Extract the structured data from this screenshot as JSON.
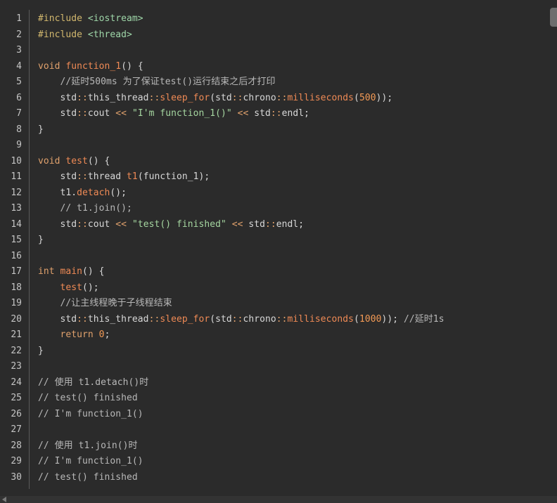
{
  "colors": {
    "background": "#2b2b2b",
    "line_number": "#c5c5c5",
    "preprocessor": "#d2b86e",
    "header": "#9fd7a9",
    "keyword": "#e0a16c",
    "function": "#ef8a55",
    "string": "#a5d6a0",
    "number": "#f39a55",
    "comment": "#b8b8b8",
    "plain": "#d8d8d8"
  },
  "editor": {
    "lines": [
      {
        "n": "1",
        "tokens": [
          [
            "pp",
            "#include"
          ],
          [
            "pl",
            " "
          ],
          [
            "hd",
            "<iostream>"
          ]
        ]
      },
      {
        "n": "2",
        "tokens": [
          [
            "pp",
            "#include"
          ],
          [
            "pl",
            " "
          ],
          [
            "hd",
            "<thread>"
          ]
        ]
      },
      {
        "n": "3",
        "tokens": []
      },
      {
        "n": "4",
        "tokens": [
          [
            "kw",
            "void"
          ],
          [
            "pl",
            " "
          ],
          [
            "fn",
            "function_1"
          ],
          [
            "pl",
            "() {"
          ]
        ]
      },
      {
        "n": "5",
        "tokens": [
          [
            "pl",
            "    "
          ],
          [
            "cm",
            "//延时500ms 为了保证test()运行结束之后才打印"
          ]
        ]
      },
      {
        "n": "6",
        "tokens": [
          [
            "pl",
            "    std"
          ],
          [
            "kw",
            "::"
          ],
          [
            "pl",
            "this_thread"
          ],
          [
            "kw",
            "::"
          ],
          [
            "fn",
            "sleep_for"
          ],
          [
            "pl",
            "(std"
          ],
          [
            "kw",
            "::"
          ],
          [
            "pl",
            "chrono"
          ],
          [
            "kw",
            "::"
          ],
          [
            "fn",
            "milliseconds"
          ],
          [
            "pl",
            "("
          ],
          [
            "num",
            "500"
          ],
          [
            "pl",
            "));"
          ]
        ]
      },
      {
        "n": "7",
        "tokens": [
          [
            "pl",
            "    std"
          ],
          [
            "kw",
            "::"
          ],
          [
            "pl",
            "cout "
          ],
          [
            "kw",
            "<<"
          ],
          [
            "pl",
            " "
          ],
          [
            "str",
            "\"I'm function_1()\""
          ],
          [
            "pl",
            " "
          ],
          [
            "kw",
            "<<"
          ],
          [
            "pl",
            " std"
          ],
          [
            "kw",
            "::"
          ],
          [
            "pl",
            "endl;"
          ]
        ]
      },
      {
        "n": "8",
        "tokens": [
          [
            "pl",
            "}"
          ]
        ]
      },
      {
        "n": "9",
        "tokens": []
      },
      {
        "n": "10",
        "tokens": [
          [
            "kw",
            "void"
          ],
          [
            "pl",
            " "
          ],
          [
            "fn",
            "test"
          ],
          [
            "pl",
            "() {"
          ]
        ]
      },
      {
        "n": "11",
        "tokens": [
          [
            "pl",
            "    std"
          ],
          [
            "kw",
            "::"
          ],
          [
            "pl",
            "thread "
          ],
          [
            "fn",
            "t1"
          ],
          [
            "pl",
            "(function_1);"
          ]
        ]
      },
      {
        "n": "12",
        "tokens": [
          [
            "pl",
            "    t1."
          ],
          [
            "fn",
            "detach"
          ],
          [
            "pl",
            "();"
          ]
        ]
      },
      {
        "n": "13",
        "tokens": [
          [
            "pl",
            "    "
          ],
          [
            "cm",
            "// t1.join();"
          ]
        ]
      },
      {
        "n": "14",
        "tokens": [
          [
            "pl",
            "    std"
          ],
          [
            "kw",
            "::"
          ],
          [
            "pl",
            "cout "
          ],
          [
            "kw",
            "<<"
          ],
          [
            "pl",
            " "
          ],
          [
            "str",
            "\"test() finished\""
          ],
          [
            "pl",
            " "
          ],
          [
            "kw",
            "<<"
          ],
          [
            "pl",
            " std"
          ],
          [
            "kw",
            "::"
          ],
          [
            "pl",
            "endl;"
          ]
        ]
      },
      {
        "n": "15",
        "tokens": [
          [
            "pl",
            "}"
          ]
        ]
      },
      {
        "n": "16",
        "tokens": []
      },
      {
        "n": "17",
        "tokens": [
          [
            "kw",
            "int"
          ],
          [
            "pl",
            " "
          ],
          [
            "fn",
            "main"
          ],
          [
            "pl",
            "() {"
          ]
        ]
      },
      {
        "n": "18",
        "tokens": [
          [
            "pl",
            "    "
          ],
          [
            "fn",
            "test"
          ],
          [
            "pl",
            "();"
          ]
        ]
      },
      {
        "n": "19",
        "tokens": [
          [
            "pl",
            "    "
          ],
          [
            "cm",
            "//让主线程晚于子线程结束"
          ]
        ]
      },
      {
        "n": "20",
        "tokens": [
          [
            "pl",
            "    std"
          ],
          [
            "kw",
            "::"
          ],
          [
            "pl",
            "this_thread"
          ],
          [
            "kw",
            "::"
          ],
          [
            "fn",
            "sleep_for"
          ],
          [
            "pl",
            "(std"
          ],
          [
            "kw",
            "::"
          ],
          [
            "pl",
            "chrono"
          ],
          [
            "kw",
            "::"
          ],
          [
            "fn",
            "milliseconds"
          ],
          [
            "pl",
            "("
          ],
          [
            "num",
            "1000"
          ],
          [
            "pl",
            ")); "
          ],
          [
            "cm",
            "//延时1s"
          ]
        ]
      },
      {
        "n": "21",
        "tokens": [
          [
            "pl",
            "    "
          ],
          [
            "kw",
            "return"
          ],
          [
            "pl",
            " "
          ],
          [
            "num",
            "0"
          ],
          [
            "pl",
            ";"
          ]
        ]
      },
      {
        "n": "22",
        "tokens": [
          [
            "pl",
            "}"
          ]
        ]
      },
      {
        "n": "23",
        "tokens": []
      },
      {
        "n": "24",
        "tokens": [
          [
            "cm",
            "// 使用 t1.detach()时"
          ]
        ]
      },
      {
        "n": "25",
        "tokens": [
          [
            "cm",
            "// test() finished"
          ]
        ]
      },
      {
        "n": "26",
        "tokens": [
          [
            "cm",
            "// I'm function_1()"
          ]
        ]
      },
      {
        "n": "27",
        "tokens": []
      },
      {
        "n": "28",
        "tokens": [
          [
            "cm",
            "// 使用 t1.join()时"
          ]
        ]
      },
      {
        "n": "29",
        "tokens": [
          [
            "cm",
            "// I'm function_1()"
          ]
        ]
      },
      {
        "n": "30",
        "tokens": [
          [
            "cm",
            "// test() finished"
          ]
        ]
      }
    ]
  }
}
